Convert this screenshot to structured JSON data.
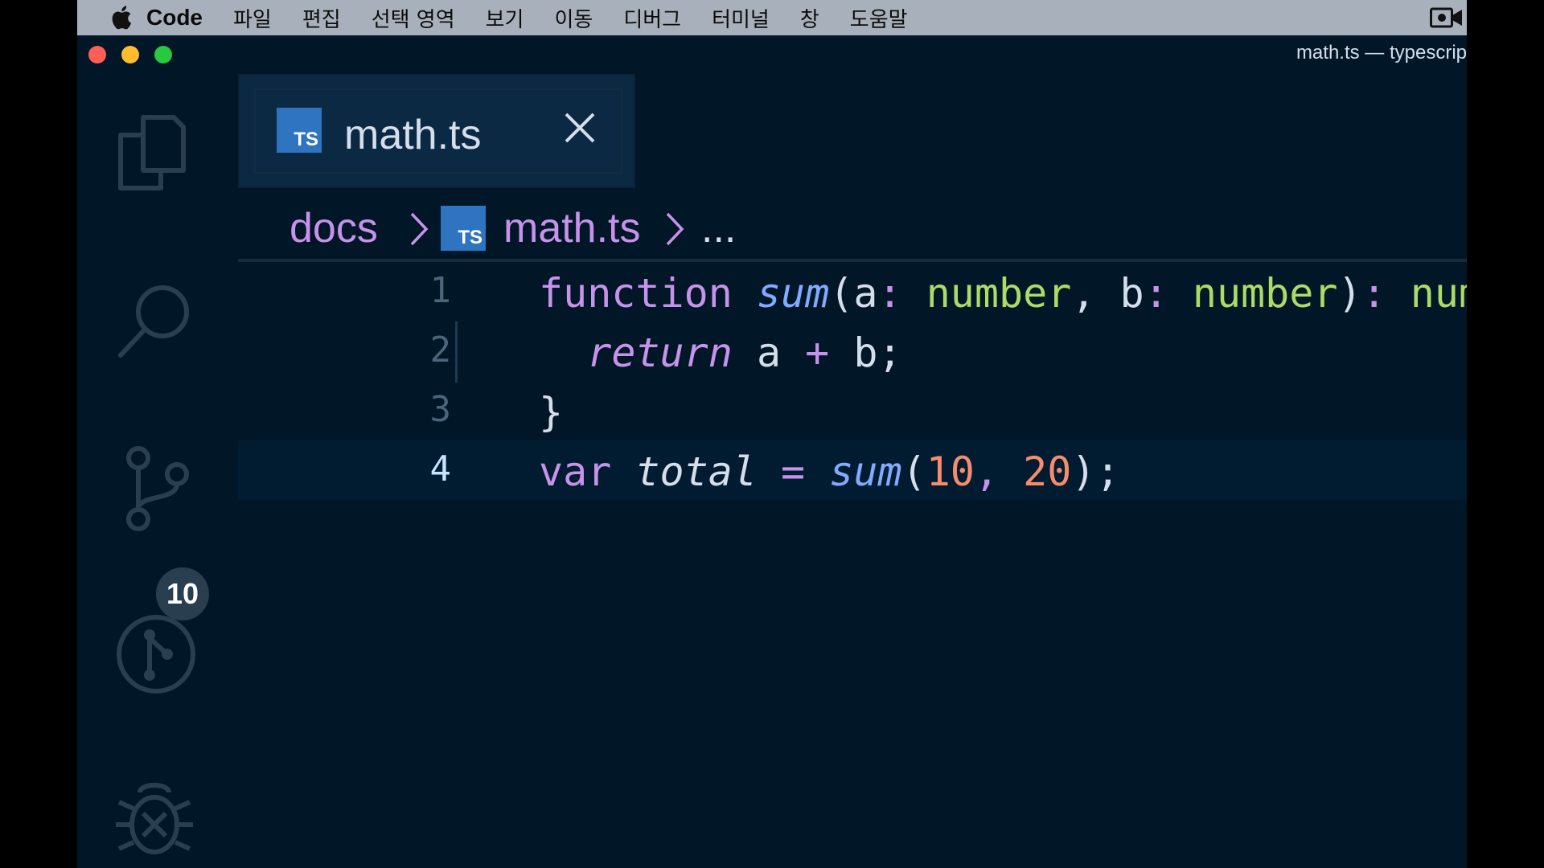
{
  "menubar": {
    "app_name": "Code",
    "items": [
      "파일",
      "편집",
      "선택 영역",
      "보기",
      "이동",
      "디버그",
      "터미널",
      "창",
      "도움말"
    ]
  },
  "window": {
    "title": "math.ts — typescrip"
  },
  "activity_bar": {
    "items": [
      "explorer-icon",
      "search-icon",
      "source-control-icon",
      "git-graph-icon",
      "debug-icon"
    ],
    "source_control_badge": "10"
  },
  "tab": {
    "label": "math.ts",
    "icon_text": "TS"
  },
  "breadcrumb": {
    "folder": "docs",
    "file": "math.ts",
    "more": "...",
    "icon_text": "TS"
  },
  "editor": {
    "line_numbers": [
      "1",
      "2",
      "3",
      "4"
    ],
    "current_line": 4,
    "lines": [
      {
        "tokens": [
          "function",
          " ",
          "sum",
          "(a",
          ":",
          " ",
          "number",
          ", b",
          ":",
          " ",
          "number",
          ")",
          ":",
          " ",
          "number"
        ]
      },
      {
        "tokens": [
          "  ",
          "return",
          " a ",
          "+",
          " b;"
        ]
      },
      {
        "tokens": [
          "}"
        ]
      },
      {
        "tokens": [
          "var",
          " ",
          "total",
          " ",
          "=",
          " ",
          "sum",
          "(",
          "10",
          ",",
          " ",
          "20",
          ");"
        ]
      }
    ]
  },
  "colors": {
    "background": "#011627",
    "keyword": "#c792ea",
    "function": "#82aaff",
    "type": "#addb67",
    "number": "#f78c6c",
    "text": "#d6deeb"
  }
}
